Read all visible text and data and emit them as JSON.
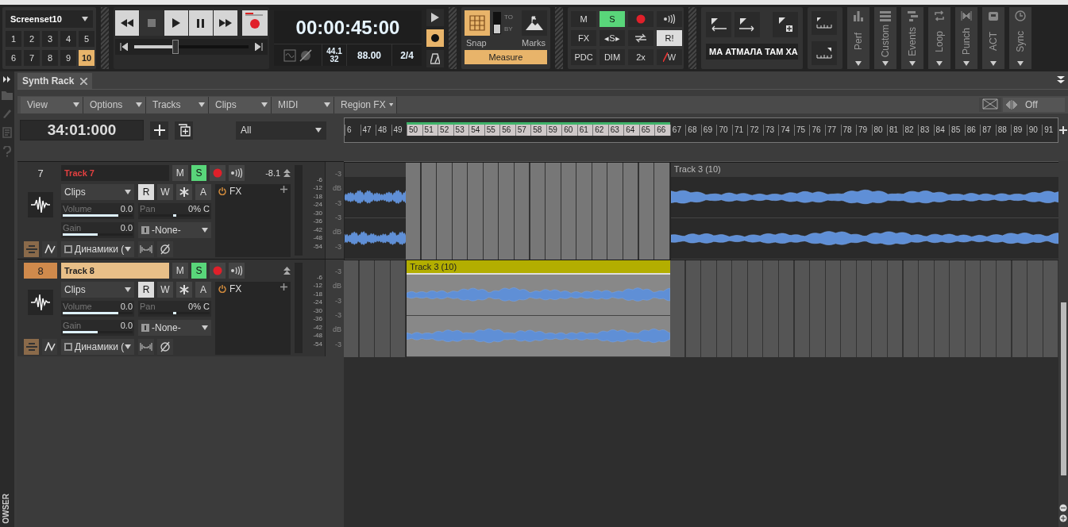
{
  "screenset": {
    "name": "Screenset10",
    "buttons": [
      {
        "label": "1",
        "selected": false
      },
      {
        "label": "2",
        "selected": false
      },
      {
        "label": "3",
        "selected": false
      },
      {
        "label": "4",
        "selected": false
      },
      {
        "label": "5",
        "selected": false
      },
      {
        "label": "6",
        "selected": false
      },
      {
        "label": "7",
        "selected": false
      },
      {
        "label": "8",
        "selected": false
      },
      {
        "label": "9",
        "selected": false
      },
      {
        "label": "10",
        "selected": true
      }
    ]
  },
  "transport": {
    "time": "00:00:45:00",
    "sample_rate": "44.1",
    "bit_depth": "32",
    "tempo": "88.00",
    "meter": "2/4",
    "position": {
      "level": 0.36
    }
  },
  "side_buttons": [
    {
      "kind": "play",
      "on": false
    },
    {
      "kind": "record",
      "on": true
    },
    {
      "kind": "metronome",
      "on": false
    }
  ],
  "snap": {
    "on": true,
    "by_selected": true,
    "to_label": "TO",
    "by_label": "BY",
    "snap_label": "Snap",
    "marks_label": "Marks",
    "resolution": "Measure"
  },
  "mix_buttons": [
    {
      "kind": "text",
      "label": "M",
      "on": false
    },
    {
      "kind": "text",
      "label": "S",
      "on": true
    },
    {
      "kind": "record",
      "on": false
    },
    {
      "kind": "speaker",
      "on": false
    },
    {
      "kind": "text",
      "label": "FX",
      "on": false
    },
    {
      "kind": "text",
      "label": "◂S▸",
      "on": false
    },
    {
      "kind": "sync",
      "on": false
    },
    {
      "kind": "text",
      "label": "R!",
      "on": true
    },
    {
      "kind": "text",
      "label": "PDC",
      "on": false
    },
    {
      "kind": "text",
      "label": "DIM",
      "on": false
    },
    {
      "kind": "text",
      "label": "2x",
      "on": false
    },
    {
      "kind": "struck",
      "label": "W",
      "on": false
    }
  ],
  "marquee": "МА АТМАЛА ТАМ ХА",
  "modules": [
    {
      "label": "Perf",
      "kind": "bars"
    },
    {
      "label": "Custom",
      "kind": "lines"
    },
    {
      "label": "Events",
      "kind": "steps"
    },
    {
      "label": "Loop",
      "kind": "loop"
    },
    {
      "label": "Punch",
      "kind": "punch"
    },
    {
      "label": "ACT",
      "kind": "act"
    },
    {
      "label": "Sync",
      "kind": "clock"
    }
  ],
  "tab": {
    "label": "Synth Rack"
  },
  "menus": [
    "View",
    "Options",
    "Tracks",
    "Clips",
    "MIDI",
    "Region FX"
  ],
  "crossfade": "Off",
  "now_time": "34:01:000",
  "filter": "All",
  "ruler": [
    {
      "label": "6",
      "selected": false
    },
    {
      "label": "47",
      "selected": false
    },
    {
      "label": "48",
      "selected": false
    },
    {
      "label": "49",
      "selected": false
    },
    {
      "label": "50",
      "selected": true
    },
    {
      "label": "51",
      "selected": true
    },
    {
      "label": "52",
      "selected": true
    },
    {
      "label": "53",
      "selected": true
    },
    {
      "label": "54",
      "selected": true
    },
    {
      "label": "55",
      "selected": true
    },
    {
      "label": "56",
      "selected": true
    },
    {
      "label": "57",
      "selected": true
    },
    {
      "label": "58",
      "selected": true
    },
    {
      "label": "59",
      "selected": true
    },
    {
      "label": "60",
      "selected": true
    },
    {
      "label": "61",
      "selected": true
    },
    {
      "label": "62",
      "selected": true
    },
    {
      "label": "63",
      "selected": true
    },
    {
      "label": "64",
      "selected": true
    },
    {
      "label": "65",
      "selected": true
    },
    {
      "label": "66",
      "selected": true
    },
    {
      "label": "67",
      "selected": false
    },
    {
      "label": "68",
      "selected": false
    },
    {
      "label": "69",
      "selected": false
    },
    {
      "label": "70",
      "selected": false
    },
    {
      "label": "71",
      "selected": false
    },
    {
      "label": "72",
      "selected": false
    },
    {
      "label": "73",
      "selected": false
    },
    {
      "label": "74",
      "selected": false
    },
    {
      "label": "75",
      "selected": false
    },
    {
      "label": "76",
      "selected": false
    },
    {
      "label": "77",
      "selected": false
    },
    {
      "label": "78",
      "selected": false
    },
    {
      "label": "79",
      "selected": false
    },
    {
      "label": "80",
      "selected": false
    },
    {
      "label": "81",
      "selected": false
    },
    {
      "label": "82",
      "selected": false
    },
    {
      "label": "83",
      "selected": false
    },
    {
      "label": "84",
      "selected": false
    },
    {
      "label": "85",
      "selected": false
    },
    {
      "label": "86",
      "selected": false
    },
    {
      "label": "87",
      "selected": false
    },
    {
      "label": "88",
      "selected": false
    },
    {
      "label": "89",
      "selected": false
    },
    {
      "label": "90",
      "selected": false
    },
    {
      "label": "91",
      "selected": false
    }
  ],
  "tracks": [
    {
      "number": "7",
      "name": "Track 7",
      "selected": false,
      "input": "Clips",
      "fx": "FX",
      "volume": {
        "label": "Volume",
        "value": "0.0",
        "level": 0.8
      },
      "pan": {
        "label": "Pan",
        "value": "0% C",
        "level": 0.5
      },
      "gain": {
        "label": "Gain",
        "value": "0.0",
        "level": 0.5
      },
      "input_port": "-None-",
      "output": "Динамики (",
      "peak": "-8.1",
      "meter_scale": [
        "-6",
        "-12",
        "-18",
        "-24",
        "-30",
        "-36",
        "-42",
        "-48",
        "-54"
      ],
      "lane_scale": [
        "-3",
        "dB",
        "-3",
        "-3",
        "dB",
        "-3"
      ],
      "buttons": [
        {
          "kind": "text",
          "label": "M",
          "on": false
        },
        {
          "kind": "text",
          "label": "S",
          "on": true
        },
        {
          "kind": "record",
          "on": false
        },
        {
          "kind": "speaker",
          "on": false
        }
      ],
      "mode_buttons": [
        {
          "kind": "text",
          "label": "R",
          "on": true
        },
        {
          "kind": "text",
          "label": "W",
          "on": false
        },
        {
          "kind": "asterisk",
          "on": false
        },
        {
          "kind": "text",
          "label": "A",
          "on": false
        }
      ],
      "clips": [
        {
          "kind": "before",
          "selected": false
        },
        {
          "kind": "after",
          "title": "Track 3 (10)",
          "selected": false
        }
      ]
    },
    {
      "number": "8",
      "name": "Track 8",
      "selected": true,
      "input": "Clips",
      "fx": "FX",
      "volume": {
        "label": "Volume",
        "value": "0.0",
        "level": 0.8
      },
      "pan": {
        "label": "Pan",
        "value": "0% C",
        "level": 0.5
      },
      "gain": {
        "label": "Gain",
        "value": "0.0",
        "level": 0.5
      },
      "input_port": "-None-",
      "output": "Динамики (",
      "meter_scale": [
        "-6",
        "-12",
        "-18",
        "-24",
        "-30",
        "-36",
        "-42",
        "-48",
        "-54"
      ],
      "lane_scale": [
        "-3",
        "dB",
        "-3",
        "-3",
        "dB",
        "-3"
      ],
      "buttons": [
        {
          "kind": "text",
          "label": "M",
          "on": false
        },
        {
          "kind": "text",
          "label": "S",
          "on": true
        },
        {
          "kind": "record",
          "on": false
        },
        {
          "kind": "speaker",
          "on": false
        }
      ],
      "mode_buttons": [
        {
          "kind": "text",
          "label": "R",
          "on": true
        },
        {
          "kind": "text",
          "label": "W",
          "on": false
        },
        {
          "kind": "asterisk",
          "on": false
        },
        {
          "kind": "text",
          "label": "A",
          "on": false
        }
      ],
      "clips": [
        {
          "kind": "selection",
          "title": "Track 3 (10)",
          "selected": true
        }
      ]
    }
  ],
  "browser_label": "OWSER"
}
